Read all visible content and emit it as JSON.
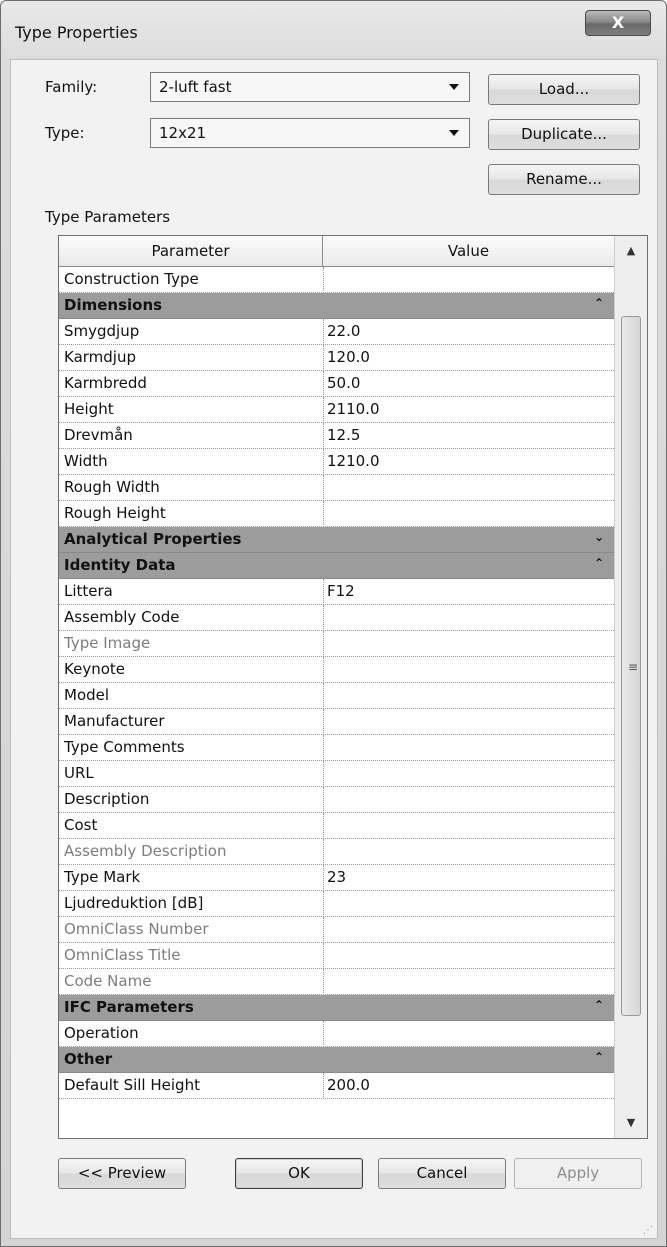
{
  "window": {
    "title": "Type Properties",
    "close_label": "X"
  },
  "family": {
    "label": "Family:",
    "value": "2-luft fast"
  },
  "type": {
    "label": "Type:",
    "value": "12x21"
  },
  "buttons": {
    "load": "Load...",
    "duplicate": "Duplicate...",
    "rename": "Rename..."
  },
  "section_label": "Type Parameters",
  "table": {
    "headers": [
      "Parameter",
      "Value"
    ],
    "rows": [
      {
        "kind": "row",
        "param": "Construction Type",
        "value": ""
      },
      {
        "kind": "group",
        "label": "Dimensions",
        "chevron": "up"
      },
      {
        "kind": "row",
        "param": "Smygdjup",
        "value": "22.0"
      },
      {
        "kind": "row",
        "param": "Karmdjup",
        "value": "120.0"
      },
      {
        "kind": "row",
        "param": "Karmbredd",
        "value": "50.0"
      },
      {
        "kind": "row",
        "param": "Height",
        "value": "2110.0"
      },
      {
        "kind": "row",
        "param": "Drevmån",
        "value": "12.5"
      },
      {
        "kind": "row",
        "param": "Width",
        "value": "1210.0"
      },
      {
        "kind": "row",
        "param": "Rough Width",
        "value": ""
      },
      {
        "kind": "row",
        "param": "Rough Height",
        "value": ""
      },
      {
        "kind": "group",
        "label": "Analytical Properties",
        "chevron": "down"
      },
      {
        "kind": "group",
        "label": "Identity Data",
        "chevron": "up"
      },
      {
        "kind": "row",
        "param": "Littera",
        "value": "F12"
      },
      {
        "kind": "row",
        "param": "Assembly Code",
        "value": ""
      },
      {
        "kind": "row",
        "param": "Type Image",
        "value": "",
        "dim": true
      },
      {
        "kind": "row",
        "param": "Keynote",
        "value": ""
      },
      {
        "kind": "row",
        "param": "Model",
        "value": ""
      },
      {
        "kind": "row",
        "param": "Manufacturer",
        "value": ""
      },
      {
        "kind": "row",
        "param": "Type Comments",
        "value": ""
      },
      {
        "kind": "row",
        "param": "URL",
        "value": ""
      },
      {
        "kind": "row",
        "param": "Description",
        "value": ""
      },
      {
        "kind": "row",
        "param": "Cost",
        "value": ""
      },
      {
        "kind": "row",
        "param": "Assembly Description",
        "value": "",
        "dim": true
      },
      {
        "kind": "row",
        "param": "Type Mark",
        "value": "23"
      },
      {
        "kind": "row",
        "param": "Ljudreduktion [dB]",
        "value": ""
      },
      {
        "kind": "row",
        "param": "OmniClass Number",
        "value": "",
        "dim": true
      },
      {
        "kind": "row",
        "param": "OmniClass Title",
        "value": "",
        "dim": true
      },
      {
        "kind": "row",
        "param": "Code Name",
        "value": "",
        "dim": true
      },
      {
        "kind": "group",
        "label": "IFC Parameters",
        "chevron": "up"
      },
      {
        "kind": "row",
        "param": "Operation",
        "value": ""
      },
      {
        "kind": "group",
        "label": "Other",
        "chevron": "up"
      },
      {
        "kind": "row",
        "param": "Default Sill Height",
        "value": "200.0"
      }
    ]
  },
  "footer": {
    "preview": "<< Preview",
    "ok": "OK",
    "cancel": "Cancel",
    "apply": "Apply"
  },
  "icons": {
    "close": "close-icon",
    "dropdown": "chevron-down-icon",
    "collapse": "collapse-icon",
    "expand": "expand-icon"
  }
}
